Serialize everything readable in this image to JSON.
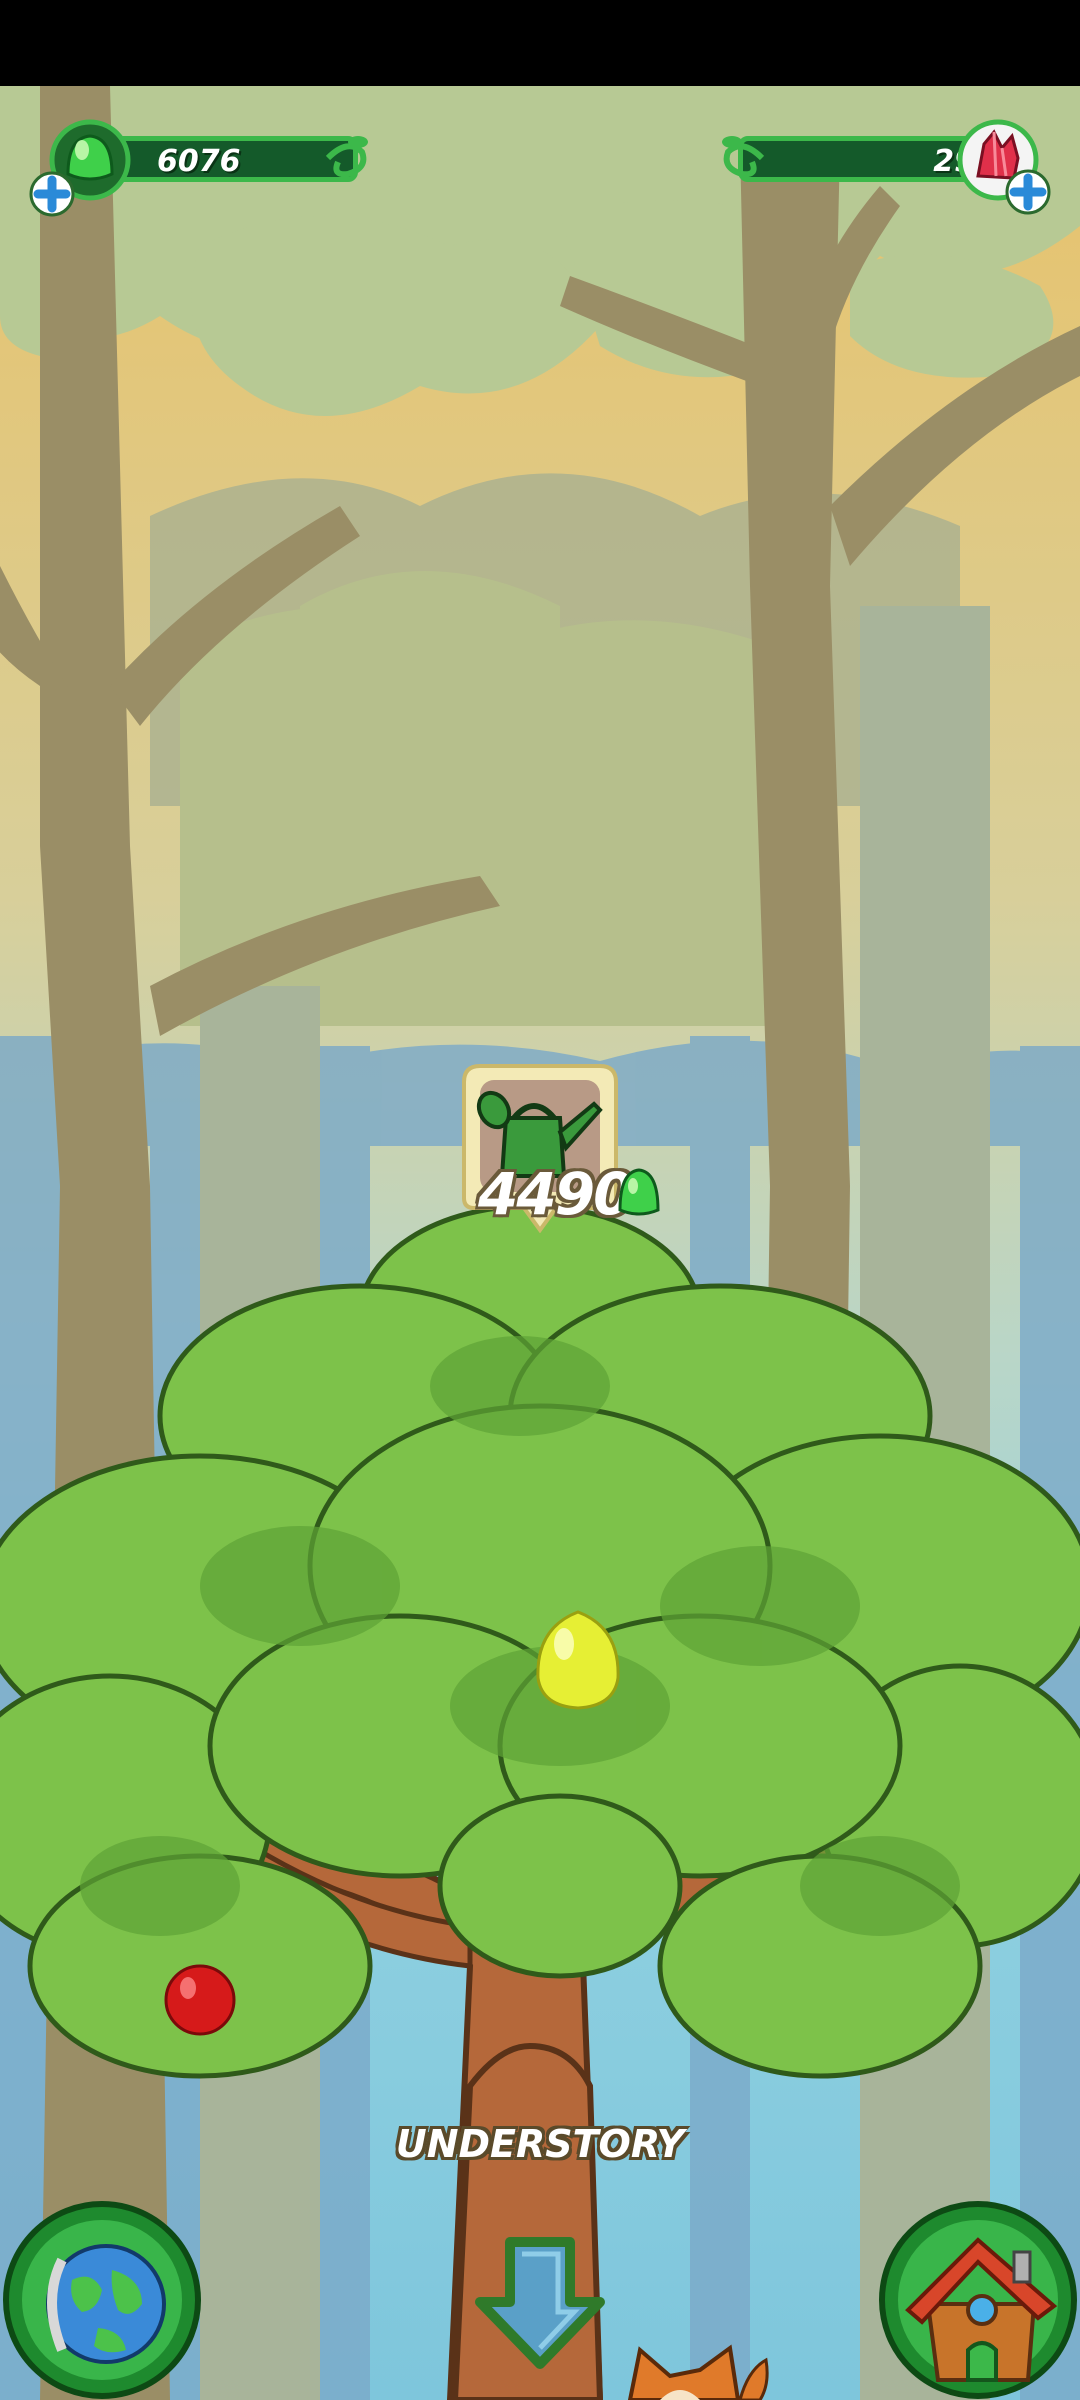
{
  "hud": {
    "green_currency": "6076",
    "red_currency": "29"
  },
  "tree": {
    "upgrade_cost": "4490",
    "level_name": "UNDERSTORY"
  },
  "icons": {
    "green": "green-gem-icon",
    "red": "red-crystal-icon",
    "plus": "plus-icon",
    "can": "watering-can-icon",
    "globe": "globe-icon",
    "house": "house-icon",
    "down": "down-arrow-icon"
  },
  "colors": {
    "hud_bar": "#145a2a",
    "hud_border": "#3cb84a",
    "leaf": "#7dc24a",
    "trunk": "#b5683a",
    "sky": "#8fd0e0"
  }
}
